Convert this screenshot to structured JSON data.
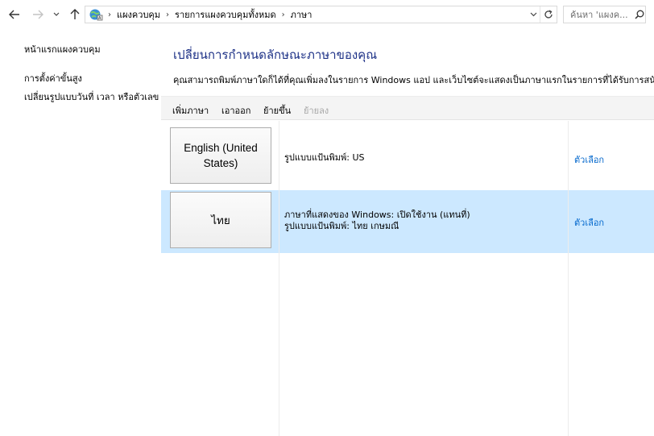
{
  "address_bar": {
    "breadcrumbs": [
      "แผงควบคุม",
      "รายการแผงควบคุมทั้งหมด",
      "ภาษา"
    ],
    "search_placeholder": "ค้นหา 'แผงค..."
  },
  "left_pane": {
    "links": [
      "หน้าแรกแผงควบคุม",
      "การตั้งค่าขั้นสูง",
      "เปลี่ยนรูปแบบวันที่ เวลา หรือตัวเลข"
    ]
  },
  "main": {
    "title": "เปลี่ยนการกำหนดลักษณะภาษาของคุณ",
    "description": "คุณสามารถพิมพ์ภาษาใดก็ได้ที่คุณเพิ่มลงในรายการ Windows แอป และเว็บไซต์จะแสดงเป็นภาษาแรกในรายการที่ได้รับการสนับสนุน",
    "toolbar": {
      "add": "เพิ่มภาษา",
      "remove": "เอาออก",
      "move_up": "ย้ายขึ้น",
      "move_down": "ย้ายลง"
    },
    "languages": [
      {
        "name": "English (United States)",
        "line1": "รูปแบบแป้นพิมพ์: US",
        "line2": "",
        "options": "ตัวเลือก",
        "selected": false
      },
      {
        "name": "ไทย",
        "line1": "ภาษาที่แสดงของ Windows: เปิดใช้งาน (แทนที่)",
        "line2": "รูปแบบแป้นพิมพ์: ไทย เกษมณี",
        "options": "ตัวเลือก",
        "selected": true
      }
    ]
  },
  "icons": {
    "back": "back-arrow-icon",
    "forward": "forward-arrow-icon",
    "recent": "chevron-down-icon",
    "up": "up-arrow-icon",
    "control_panel": "control-panel-icon",
    "refresh": "refresh-icon",
    "search": "search-icon"
  },
  "colors": {
    "title": "#1e3287",
    "link": "#0066cc",
    "selected_row": "#cce8ff",
    "toolbar_bg": "#f4f4f4"
  }
}
